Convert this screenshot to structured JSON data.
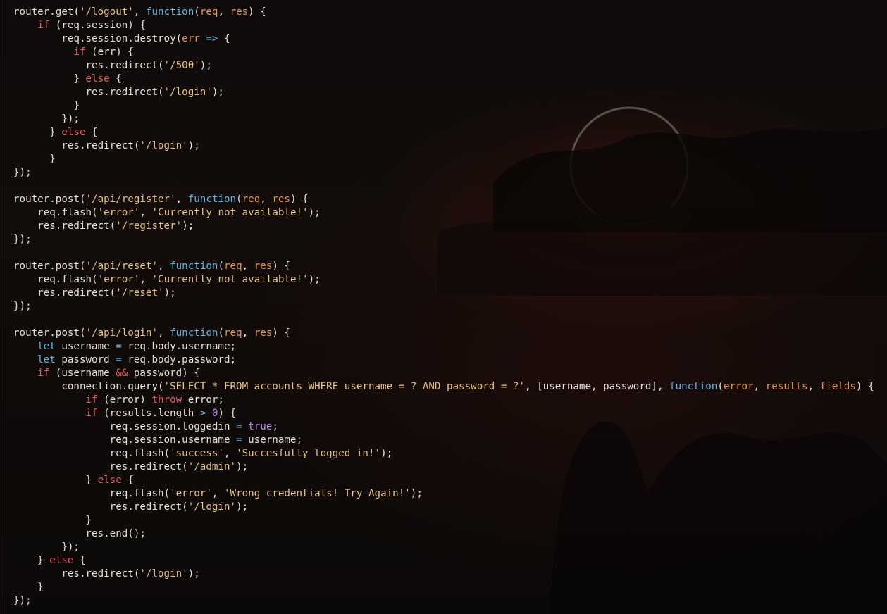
{
  "colors": {
    "background": "#0b0908",
    "text": "#e7dfd2",
    "keyword": "#e0605a",
    "function": "#5fb7e6",
    "string": "#e6c27a",
    "parameter": "#e6963a",
    "operator": "#5fb7e6",
    "number": "#b58cf0"
  },
  "code_lines": [
    [
      [
        "t",
        "router.get("
      ],
      [
        "s",
        "'/logout'"
      ],
      [
        "t",
        ", "
      ],
      [
        "f",
        "function"
      ],
      [
        "t",
        "("
      ],
      [
        "p",
        "req"
      ],
      [
        "t",
        ", "
      ],
      [
        "p",
        "res"
      ],
      [
        "t",
        ") {"
      ]
    ],
    [
      [
        "t",
        "    "
      ],
      [
        "k",
        "if"
      ],
      [
        "t",
        " (req.session) {"
      ]
    ],
    [
      [
        "t",
        "        req.session.destroy("
      ],
      [
        "p",
        "err"
      ],
      [
        "t",
        " "
      ],
      [
        "o",
        "=>"
      ],
      [
        "t",
        " {"
      ]
    ],
    [
      [
        "t",
        "          "
      ],
      [
        "k",
        "if"
      ],
      [
        "t",
        " (err) {"
      ]
    ],
    [
      [
        "t",
        "            res.redirect("
      ],
      [
        "s",
        "'/500'"
      ],
      [
        "t",
        ");"
      ]
    ],
    [
      [
        "t",
        "          } "
      ],
      [
        "k",
        "else"
      ],
      [
        "t",
        " {"
      ]
    ],
    [
      [
        "t",
        "            res.redirect("
      ],
      [
        "s",
        "'/login'"
      ],
      [
        "t",
        ");"
      ]
    ],
    [
      [
        "t",
        "          }"
      ]
    ],
    [
      [
        "t",
        "        });"
      ]
    ],
    [
      [
        "t",
        "      } "
      ],
      [
        "k",
        "else"
      ],
      [
        "t",
        " {"
      ]
    ],
    [
      [
        "t",
        "        res.redirect("
      ],
      [
        "s",
        "'/login'"
      ],
      [
        "t",
        ");"
      ]
    ],
    [
      [
        "t",
        "      }"
      ]
    ],
    [
      [
        "t",
        "});"
      ]
    ],
    [
      [
        "t",
        ""
      ]
    ],
    [
      [
        "t",
        "router.post("
      ],
      [
        "s",
        "'/api/register'"
      ],
      [
        "t",
        ", "
      ],
      [
        "f",
        "function"
      ],
      [
        "t",
        "("
      ],
      [
        "p",
        "req"
      ],
      [
        "t",
        ", "
      ],
      [
        "p",
        "res"
      ],
      [
        "t",
        ") {"
      ]
    ],
    [
      [
        "t",
        "    req.flash("
      ],
      [
        "s",
        "'error'"
      ],
      [
        "t",
        ", "
      ],
      [
        "s",
        "'Currently not available!'"
      ],
      [
        "t",
        ");"
      ]
    ],
    [
      [
        "t",
        "    res.redirect("
      ],
      [
        "s",
        "'/register'"
      ],
      [
        "t",
        ");"
      ]
    ],
    [
      [
        "t",
        "});"
      ]
    ],
    [
      [
        "t",
        ""
      ]
    ],
    [
      [
        "t",
        "router.post("
      ],
      [
        "s",
        "'/api/reset'"
      ],
      [
        "t",
        ", "
      ],
      [
        "f",
        "function"
      ],
      [
        "t",
        "("
      ],
      [
        "p",
        "req"
      ],
      [
        "t",
        ", "
      ],
      [
        "p",
        "res"
      ],
      [
        "t",
        ") {"
      ]
    ],
    [
      [
        "t",
        "    req.flash("
      ],
      [
        "s",
        "'error'"
      ],
      [
        "t",
        ", "
      ],
      [
        "s",
        "'Currently not available!'"
      ],
      [
        "t",
        ");"
      ]
    ],
    [
      [
        "t",
        "    res.redirect("
      ],
      [
        "s",
        "'/reset'"
      ],
      [
        "t",
        ");"
      ]
    ],
    [
      [
        "t",
        "});"
      ]
    ],
    [
      [
        "t",
        ""
      ]
    ],
    [
      [
        "t",
        "router.post("
      ],
      [
        "s",
        "'/api/login'"
      ],
      [
        "t",
        ", "
      ],
      [
        "f",
        "function"
      ],
      [
        "t",
        "("
      ],
      [
        "p",
        "req"
      ],
      [
        "t",
        ", "
      ],
      [
        "p",
        "res"
      ],
      [
        "t",
        ") {"
      ]
    ],
    [
      [
        "t",
        "    "
      ],
      [
        "f",
        "let"
      ],
      [
        "t",
        " username "
      ],
      [
        "o",
        "="
      ],
      [
        "t",
        " req.body.username;"
      ]
    ],
    [
      [
        "t",
        "    "
      ],
      [
        "f",
        "let"
      ],
      [
        "t",
        " password "
      ],
      [
        "o",
        "="
      ],
      [
        "t",
        " req.body.password;"
      ]
    ],
    [
      [
        "t",
        "    "
      ],
      [
        "k",
        "if"
      ],
      [
        "t",
        " (username "
      ],
      [
        "k",
        "&&"
      ],
      [
        "t",
        " password) {"
      ]
    ],
    [
      [
        "t",
        "        connection.query("
      ],
      [
        "s",
        "'SELECT * FROM accounts WHERE username = ? AND password = ?'"
      ],
      [
        "t",
        ", [username, password], "
      ],
      [
        "f",
        "function"
      ],
      [
        "t",
        "("
      ],
      [
        "p",
        "error"
      ],
      [
        "t",
        ", "
      ],
      [
        "p",
        "results"
      ],
      [
        "t",
        ", "
      ],
      [
        "p",
        "fields"
      ],
      [
        "t",
        ") {"
      ]
    ],
    [
      [
        "t",
        "            "
      ],
      [
        "k",
        "if"
      ],
      [
        "t",
        " (error) "
      ],
      [
        "k",
        "throw"
      ],
      [
        "t",
        " error;"
      ]
    ],
    [
      [
        "t",
        "            "
      ],
      [
        "k",
        "if"
      ],
      [
        "t",
        " (results.length "
      ],
      [
        "o",
        ">"
      ],
      [
        "t",
        " "
      ],
      [
        "n",
        "0"
      ],
      [
        "t",
        ") {"
      ]
    ],
    [
      [
        "t",
        "                req.session.loggedin "
      ],
      [
        "o",
        "="
      ],
      [
        "t",
        " "
      ],
      [
        "n",
        "true"
      ],
      [
        "t",
        ";"
      ]
    ],
    [
      [
        "t",
        "                req.session.username "
      ],
      [
        "o",
        "="
      ],
      [
        "t",
        " username;"
      ]
    ],
    [
      [
        "t",
        "                req.flash("
      ],
      [
        "s",
        "'success'"
      ],
      [
        "t",
        ", "
      ],
      [
        "s",
        "'Succesfully logged in!'"
      ],
      [
        "t",
        ");"
      ]
    ],
    [
      [
        "t",
        "                res.redirect("
      ],
      [
        "s",
        "'/admin'"
      ],
      [
        "t",
        ");"
      ]
    ],
    [
      [
        "t",
        "            } "
      ],
      [
        "k",
        "else"
      ],
      [
        "t",
        " {"
      ]
    ],
    [
      [
        "t",
        "                req.flash("
      ],
      [
        "s",
        "'error'"
      ],
      [
        "t",
        ", "
      ],
      [
        "s",
        "'Wrong credentials! Try Again!'"
      ],
      [
        "t",
        ");"
      ]
    ],
    [
      [
        "t",
        "                res.redirect("
      ],
      [
        "s",
        "'/login'"
      ],
      [
        "t",
        ");"
      ]
    ],
    [
      [
        "t",
        "            }"
      ]
    ],
    [
      [
        "t",
        "            res.end();"
      ]
    ],
    [
      [
        "t",
        "        });"
      ]
    ],
    [
      [
        "t",
        "    } "
      ],
      [
        "k",
        "else"
      ],
      [
        "t",
        " {"
      ]
    ],
    [
      [
        "t",
        "        res.redirect("
      ],
      [
        "s",
        "'/login'"
      ],
      [
        "t",
        ");"
      ]
    ],
    [
      [
        "t",
        "    }"
      ]
    ],
    [
      [
        "t",
        "});"
      ]
    ]
  ]
}
